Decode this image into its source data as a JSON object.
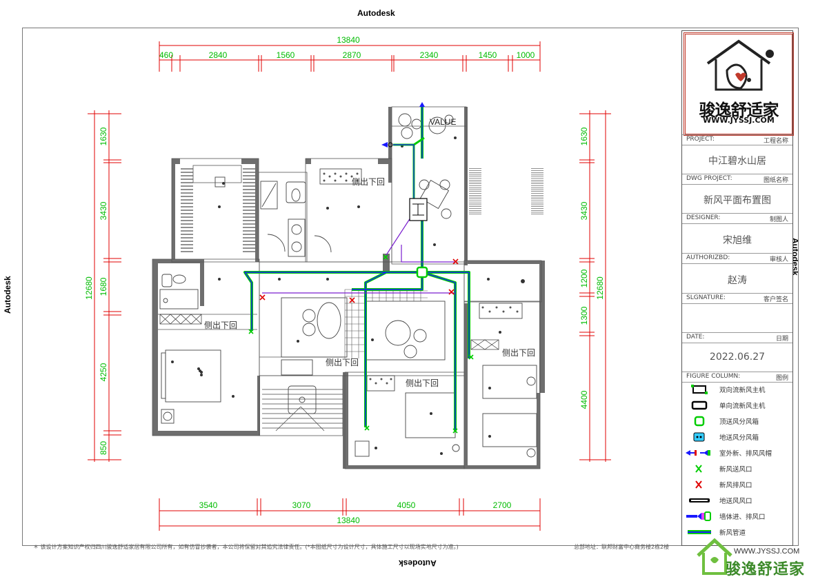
{
  "autodesk_labels": {
    "top": "Autodesk",
    "bottom": "Autodesk",
    "left": "Autodesk",
    "right": "Autodesk"
  },
  "dimensions": {
    "top_total": "13840",
    "top_segments": [
      "460",
      "2840",
      "1560",
      "2870",
      "2340",
      "1450",
      "1000"
    ],
    "bottom_total": "13840",
    "bottom_segments": [
      "3540",
      "3070",
      "4050",
      "2700"
    ],
    "left_total": "12680",
    "left_segments": [
      "1630",
      "3430",
      "1680",
      "4250",
      "850"
    ],
    "right_total": "12680",
    "right_segments": [
      "1630",
      "3430",
      "1200",
      "1300",
      "4400"
    ]
  },
  "room_labels": [
    "侧出下回",
    "侧出下回",
    "侧出下回",
    "侧出下回",
    "侧出下回"
  ],
  "equipment_label": "VALUE",
  "title_block": {
    "logo_text": "骏逸舒适家",
    "logo_url": "WWW.JYSSJ.COM",
    "project_label": "PROJECT:",
    "project_label_cn": "工程名称",
    "project_value": "中江碧水山居",
    "dwg_label": "DWG PROJECT:",
    "dwg_label_cn": "图纸名称",
    "dwg_value": "新风平面布置图",
    "designer_label": "DESIGNER:",
    "designer_label_cn": "制图人",
    "designer_value": "宋旭维",
    "author_label": "AUTHORIZBD:",
    "author_label_cn": "审核人",
    "author_value": "赵涛",
    "signature_label": "SLGNATURE:",
    "signature_label_cn": "客户签名",
    "date_label": "DATE:",
    "date_label_cn": "日期",
    "date_value": "2022.06.27",
    "figure_label": "FIGURE COLUMN:",
    "figure_label_cn": "图例"
  },
  "legend": [
    {
      "icon": "bidirectional-unit-icon",
      "text": "双向流新风主机"
    },
    {
      "icon": "unidirectional-unit-icon",
      "text": "单向流新风主机"
    },
    {
      "icon": "top-supply-box-icon",
      "text": "顶送风分风箱"
    },
    {
      "icon": "floor-supply-box-icon",
      "text": "地送风分风箱"
    },
    {
      "icon": "outdoor-hood-icon",
      "text": "室外新、排风风帽"
    },
    {
      "icon": "supply-outlet-icon",
      "text": "新风送风口"
    },
    {
      "icon": "exhaust-outlet-icon",
      "text": "新风排风口"
    },
    {
      "icon": "floor-outlet-icon",
      "text": "地送风风口"
    },
    {
      "icon": "wall-outlet-icon",
      "text": "墙体进、排风口"
    },
    {
      "icon": "duct-icon",
      "text": "新风管道"
    }
  ],
  "footer": {
    "note": "＊ 该设计方案知识产权归四川骏逸舒适家居有限公司所有，如有仿冒抄袭者，本公司将保留对其追究法律责任。(*本图纸尺寸为设计尺寸，具体施工尺寸以现场实地尺寸为准。)",
    "address": "总部地址：联邦财富中心商务楼2栋2楼",
    "watermark_url": "WWW.JYSSJ.COM",
    "watermark_name": "骏逸舒适家"
  },
  "colors": {
    "dimension": "#00cc00",
    "dim_line": "#e00000",
    "supply_duct": "#00cc00",
    "exhaust_duct": "#1a1aff",
    "brand_red": "#c0392b"
  }
}
